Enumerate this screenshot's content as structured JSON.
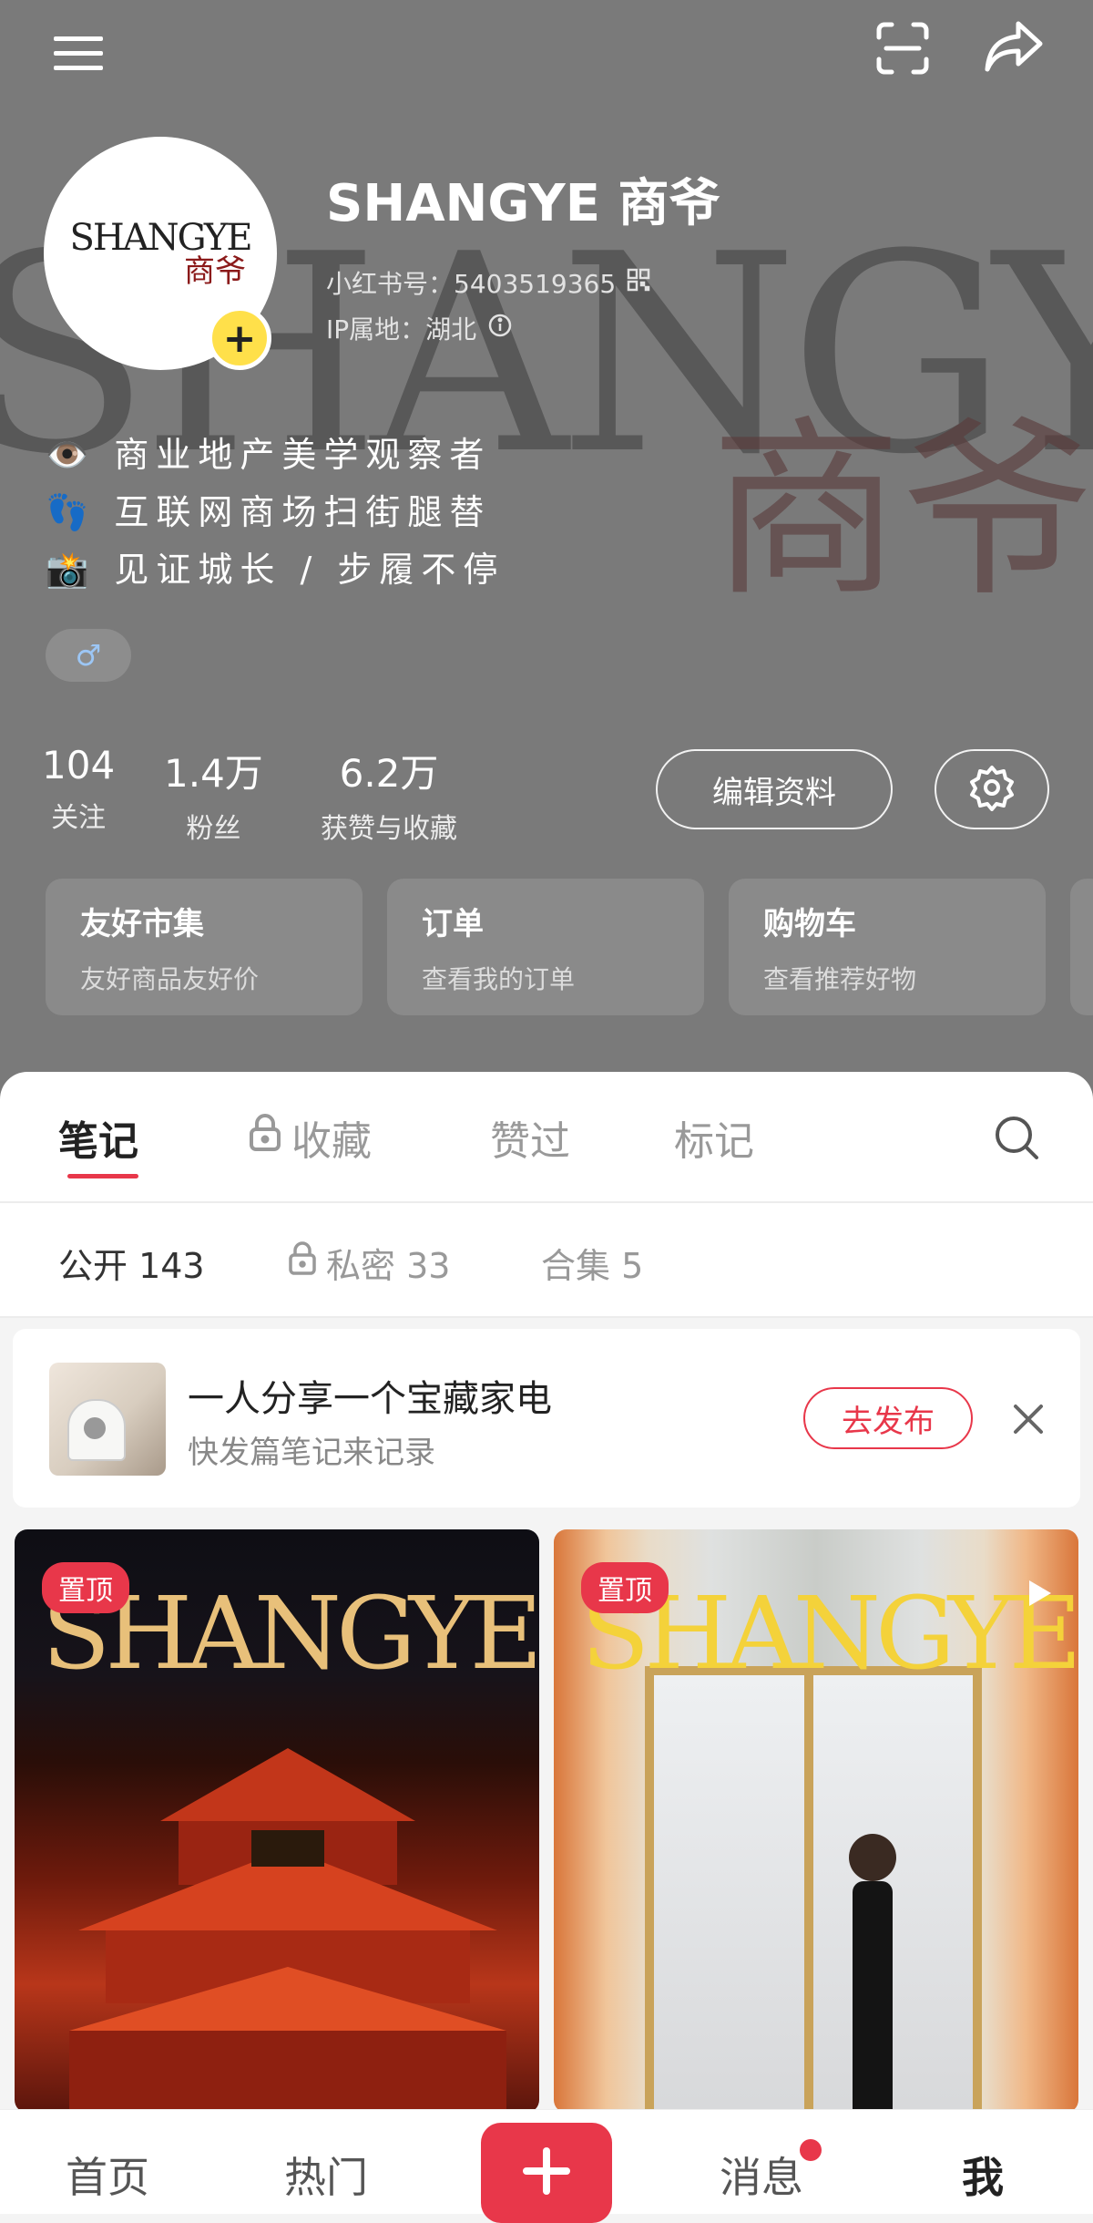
{
  "header": {
    "menu_icon": "hamburger-menu-icon",
    "scan_icon": "scan-icon",
    "share_icon": "share-icon"
  },
  "profile": {
    "background_word": "SHANGYE",
    "background_cn": "商爷",
    "avatar_text_en": "SHANGYE",
    "avatar_text_cn": "商爷",
    "name": "SHANGYE 商爷",
    "id_label": "小红书号：5403519365",
    "ip_label": "IP属地：湖北",
    "bio": [
      "👁️ 商业地产美学观察者",
      "👣 互联网商场扫街腿替",
      "📸 见证城长 / 步履不停"
    ],
    "gender_symbol": "♂"
  },
  "stats": [
    {
      "value": "104",
      "label": "关注"
    },
    {
      "value": "1.4万",
      "label": "粉丝"
    },
    {
      "value": "6.2万",
      "label": "获赞与收藏"
    }
  ],
  "actions": {
    "edit_label": "编辑资料"
  },
  "cards": [
    {
      "title": "友好市集",
      "subtitle": "友好商品友好价"
    },
    {
      "title": "订单",
      "subtitle": "查看我的订单"
    },
    {
      "title": "购物车",
      "subtitle": "查看推荐好物"
    }
  ],
  "tabs": [
    {
      "label": "笔记"
    },
    {
      "label": "收藏"
    },
    {
      "label": "赞过"
    },
    {
      "label": "标记"
    }
  ],
  "subtabs": [
    {
      "label": "公开 143"
    },
    {
      "label": "私密 33"
    },
    {
      "label": "合集 5"
    }
  ],
  "prompt": {
    "title": "一人分享一个宝藏家电",
    "subtitle": "快发篇笔记来记录",
    "publish_label": "去发布"
  },
  "posts": [
    {
      "pin_label": "置顶",
      "logo": "SHANGYE"
    },
    {
      "pin_label": "置顶",
      "logo": "SHANGYE"
    }
  ],
  "bottom_nav": [
    {
      "label": "首页"
    },
    {
      "label": "热门"
    },
    {
      "label": "消息"
    },
    {
      "label": "我"
    }
  ],
  "colors": {
    "accent": "#e8374a",
    "hero_bg": "#7a7a7a",
    "badge_yellow": "#ffe04a"
  }
}
